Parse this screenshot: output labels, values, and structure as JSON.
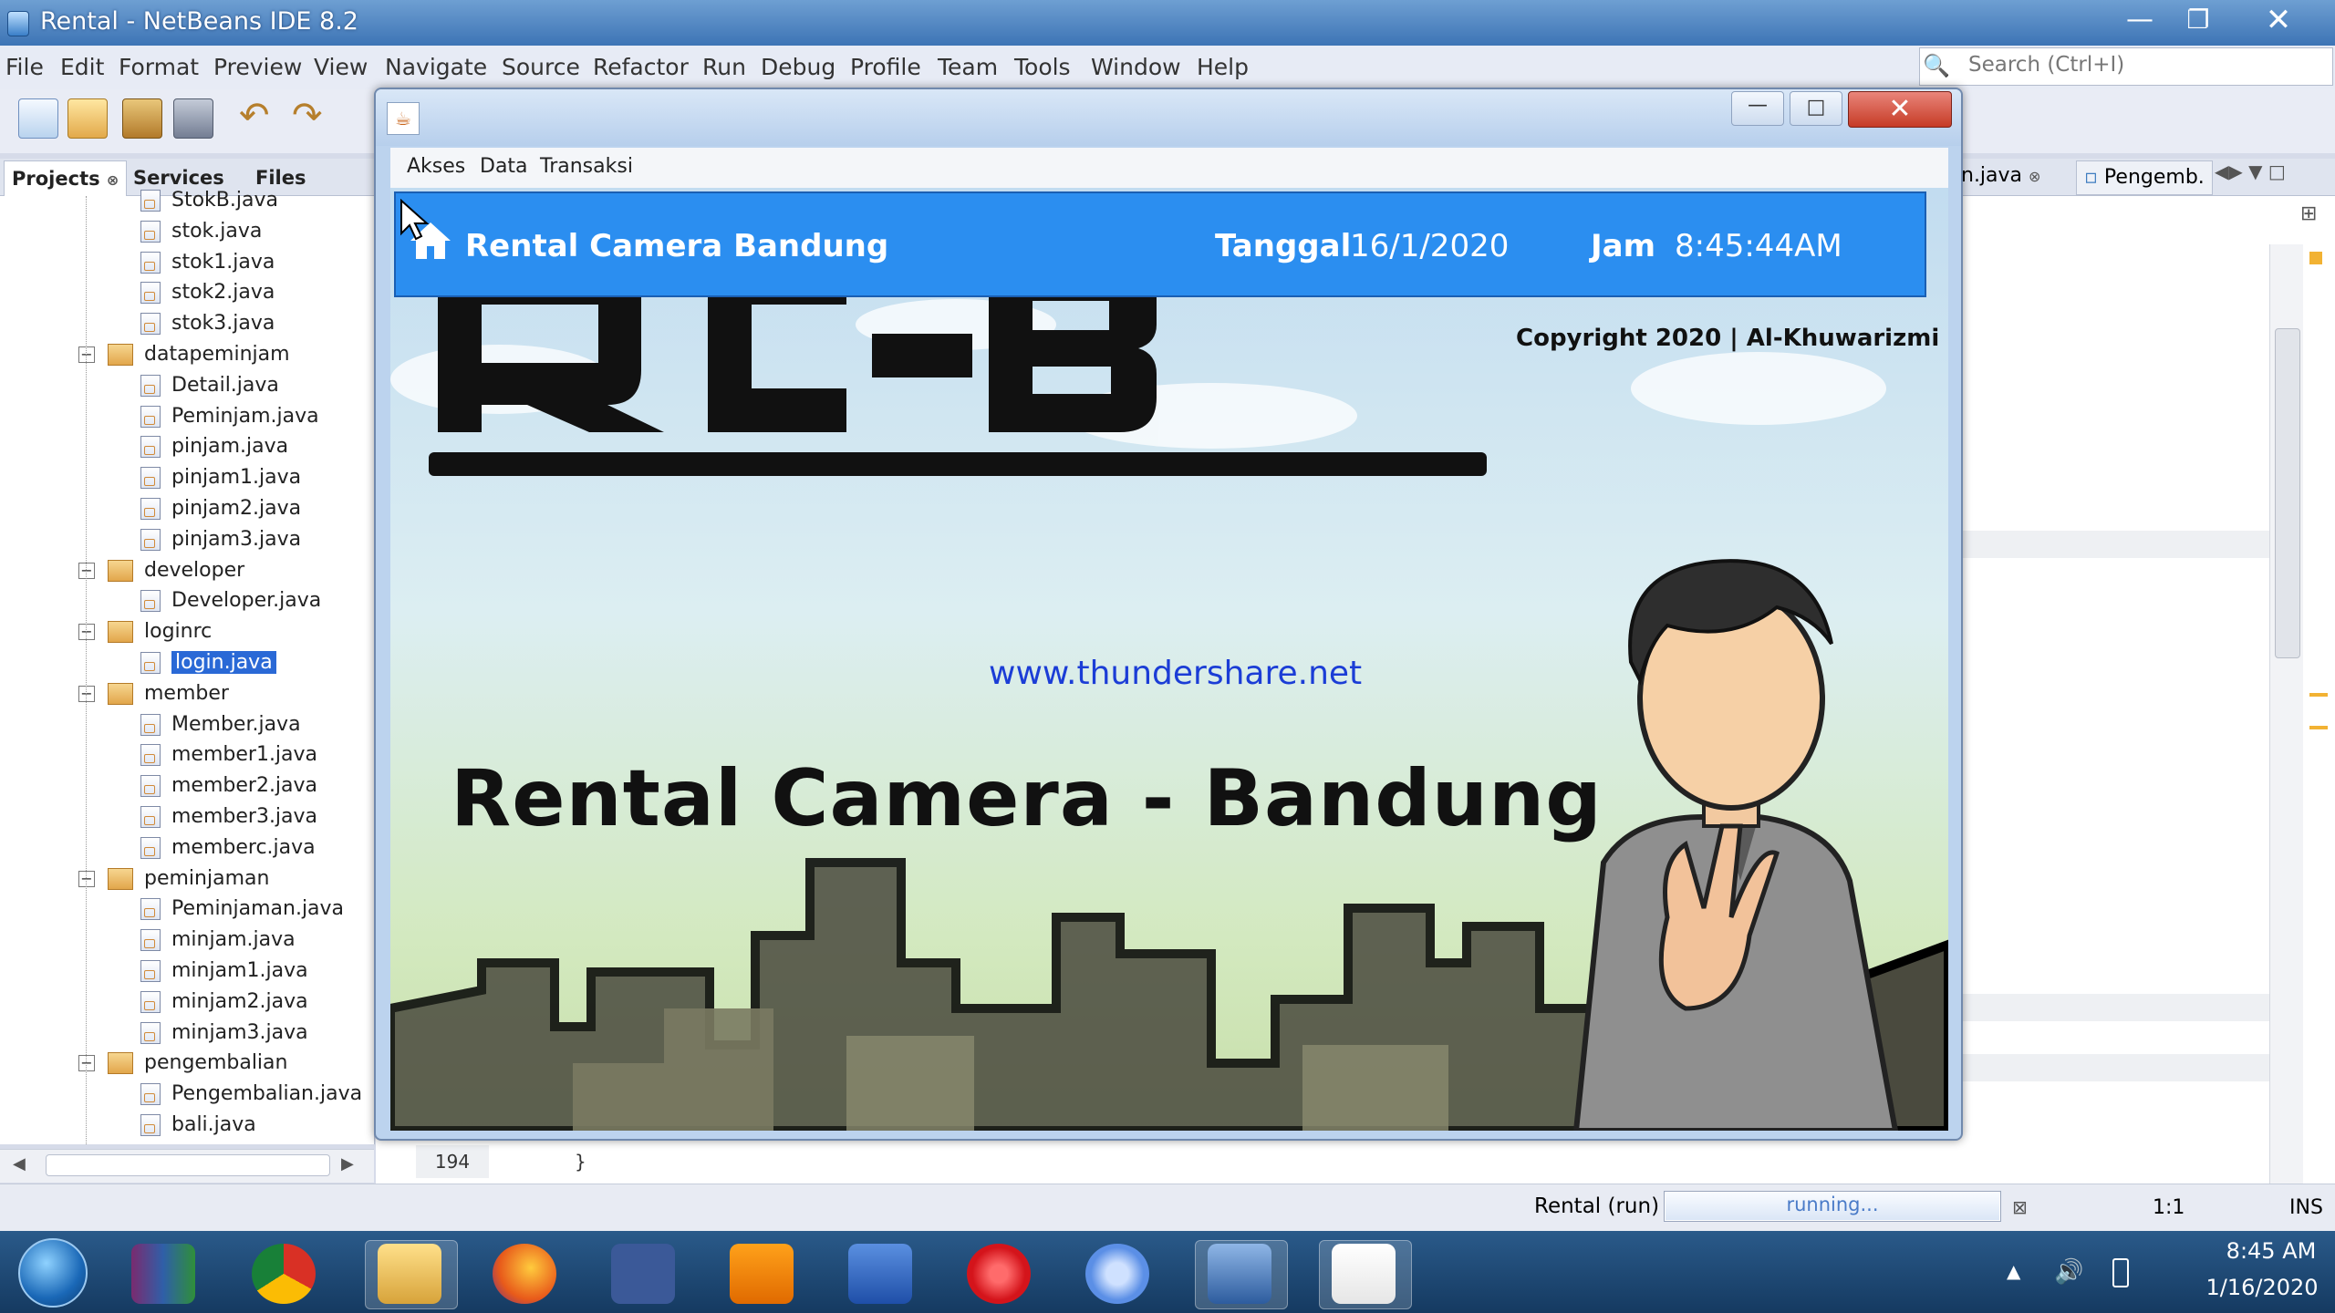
{
  "ide": {
    "title": "Rental - NetBeans IDE 8.2",
    "menu": [
      "File",
      "Edit",
      "Format",
      "Preview",
      "View",
      "Navigate",
      "Source",
      "Refactor",
      "Run",
      "Debug",
      "Profile",
      "Team",
      "Tools",
      "Window",
      "Help"
    ],
    "search_placeholder": "Search (Ctrl+I)",
    "panel_tabs": [
      "Projects",
      "Services",
      "Files"
    ],
    "editor_tabs": [
      "n.java",
      "Pengemb."
    ],
    "line_number": "194",
    "code_line": "}",
    "status": {
      "project": "Rental (run)",
      "progress_text": "running...",
      "position": "1:1",
      "mode": "INS"
    }
  },
  "tree": [
    {
      "type": "file",
      "label": "StokB.java"
    },
    {
      "type": "file",
      "label": "stok.java"
    },
    {
      "type": "file",
      "label": "stok1.java"
    },
    {
      "type": "file",
      "label": "stok2.java"
    },
    {
      "type": "file",
      "label": "stok3.java"
    },
    {
      "type": "package",
      "label": "datapeminjam"
    },
    {
      "type": "file",
      "label": "Detail.java"
    },
    {
      "type": "file",
      "label": "Peminjam.java"
    },
    {
      "type": "file",
      "label": "pinjam.java"
    },
    {
      "type": "file",
      "label": "pinjam1.java"
    },
    {
      "type": "file",
      "label": "pinjam2.java"
    },
    {
      "type": "file",
      "label": "pinjam3.java"
    },
    {
      "type": "package",
      "label": "developer"
    },
    {
      "type": "file",
      "label": "Developer.java"
    },
    {
      "type": "package",
      "label": "loginrc"
    },
    {
      "type": "file",
      "label": "login.java",
      "selected": true
    },
    {
      "type": "package",
      "label": "member"
    },
    {
      "type": "file",
      "label": "Member.java"
    },
    {
      "type": "file",
      "label": "member1.java"
    },
    {
      "type": "file",
      "label": "member2.java"
    },
    {
      "type": "file",
      "label": "member3.java"
    },
    {
      "type": "file",
      "label": "memberc.java"
    },
    {
      "type": "package",
      "label": "peminjaman"
    },
    {
      "type": "file",
      "label": "Peminjaman.java"
    },
    {
      "type": "file",
      "label": "minjam.java"
    },
    {
      "type": "file",
      "label": "minjam1.java"
    },
    {
      "type": "file",
      "label": "minjam2.java"
    },
    {
      "type": "file",
      "label": "minjam3.java"
    },
    {
      "type": "package",
      "label": "pengembalian"
    },
    {
      "type": "file",
      "label": "Pengembalian.java"
    },
    {
      "type": "file",
      "label": "bali.java"
    }
  ],
  "app": {
    "menu": [
      "Akses",
      "Data",
      "Transaksi"
    ],
    "banner_title": "Rental Camera Bandung",
    "date_label": "Tanggal",
    "date": "16/1/2020",
    "time_label": "Jam",
    "time": "8:45:44AM",
    "copyright": "Copyright 2020 | Al-Khuwarizmi",
    "logo_main": "RC-B",
    "logo_sub": "Rental Camera - Bandung",
    "watermark": "www.thundershare.net"
  },
  "taskbar": {
    "apps": [
      "winrar-icon",
      "chrome-icon",
      "file-explorer-icon",
      "firefox-icon",
      "facebook-icon",
      "vlc-icon",
      "word-icon",
      "opera-icon",
      "chromium-icon",
      "virtualbox-icon",
      "java-icon"
    ],
    "time": "8:45 AM",
    "date": "1/16/2020"
  },
  "colors": {
    "banner": "#2b8ef0",
    "ide_title": "#3d74b5",
    "selection": "#2a69d6",
    "taskbar": "#1d4a78"
  }
}
